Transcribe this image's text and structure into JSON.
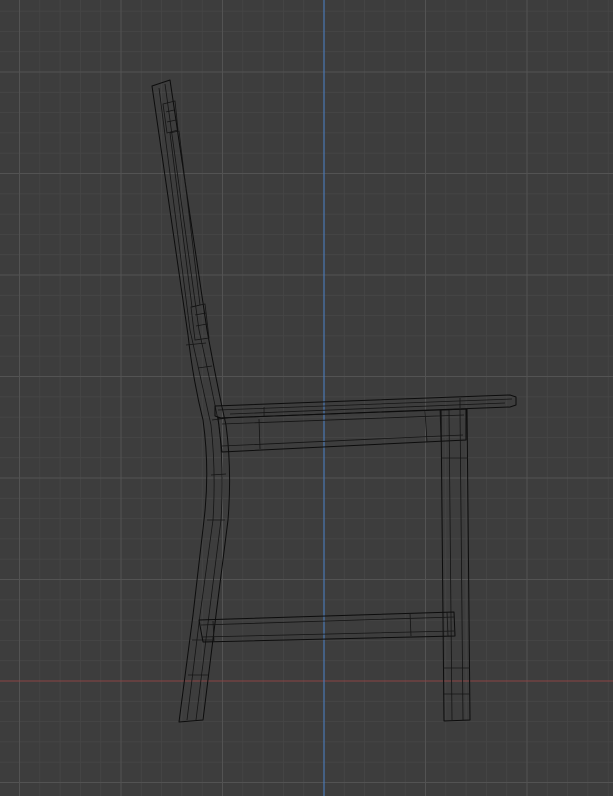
{
  "viewport": {
    "view": "side-orthographic",
    "background_color": "#3d3d3d",
    "grid": {
      "visible": true,
      "minor_color": "#464646",
      "major_color": "#535353"
    },
    "axes": {
      "vertical_axis_color": "#4a78b3",
      "horizontal_axis_color": "#8a4444"
    },
    "display_mode": "wireframe",
    "object": {
      "name": "chair",
      "wire_color": "#0c0c0c"
    }
  }
}
